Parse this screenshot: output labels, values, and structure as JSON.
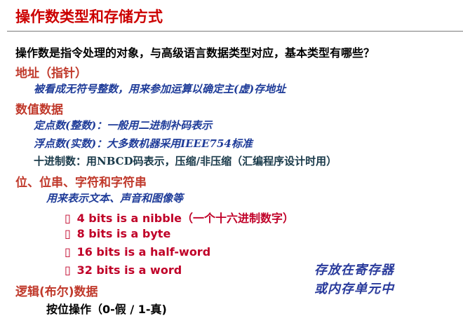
{
  "title": "操作数类型和存储方式",
  "question": "操作数是指令处理的对象，与高级语言数据类型对应，基本类型有哪些？",
  "sections": {
    "address": {
      "heading": "地址（指针）",
      "desc": "被看成无符号整数，用来参加运算以确定主(虚)存地址"
    },
    "numeric": {
      "heading": "数值数据",
      "fixed": "定点数(整数)：一般用二进制补码表示",
      "float": "浮点数(实数)：大多数机器采用IEEE754标准",
      "decimal": "十进制数：用NBCD码表示，压缩/非压缩（汇编程序设计时用）"
    },
    "bits": {
      "heading": "位、位串、字符和字符串",
      "desc": "用来表示文本、声音和图像等",
      "bullet_glyph": "▯",
      "items": [
        "4 bits is a nibble（一个十六进制数字）",
        "8 bits is a byte",
        "16 bits is a half-word",
        "32 bits is a word"
      ]
    },
    "logic": {
      "heading": "逻辑(布尔)数据",
      "desc": "按位操作（0-假 / 1-真)"
    }
  },
  "note": {
    "line1": "存放在寄存器",
    "line2": "或内存单元中"
  },
  "colors": {
    "title": "#cc0000",
    "heading": "#c0392b",
    "blue_text": "#1f3c99",
    "bullet_text": "#c00028"
  }
}
